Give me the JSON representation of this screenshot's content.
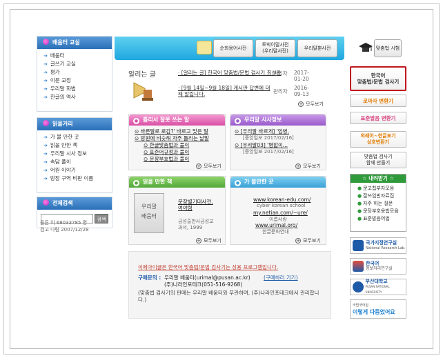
{
  "left": {
    "menu1": {
      "title": "배움터 교실",
      "items": [
        "배움터",
        "글쓰기 교실",
        "평가",
        "이문 교정",
        "우리말 화법",
        "한글의 역사"
      ]
    },
    "menu2": {
      "title": "읽을거리",
      "items": [
        "가 볼 만한 곳",
        "읽을 만한 책",
        "우리말 시사 정보",
        "속담 풀이",
        "어원 이야기",
        "방장 구역 비판 이름"
      ]
    },
    "search": {
      "title": "전체검색",
      "button": "검색"
    },
    "visits": [
      "들른 이 68033785 명",
      "검고 다림 2007/12/28"
    ]
  },
  "top": {
    "tabs": [
      "순화용어사전",
      "토박이말사전\n(우리말사전)",
      "우리말뿐사전",
      "맞춤법 시험"
    ]
  },
  "notice": {
    "title": "알리는 글",
    "rows": [
      {
        "text": "· [알리는 글] 한국어 맞춤법/문법 검사기 최신판",
        "author": "관리자",
        "date": "2017-01-20"
      },
      {
        "text": "· [9월 14일~9월 18일] 게시판 답변에 대해 알립니다.",
        "author": "관리자",
        "date": "2016-09-13"
      }
    ],
    "more": "모두보기"
  },
  "panels": {
    "p1": {
      "title": "틀리서 잘못 쓰는 말",
      "lines": [
        "⊙ 바른말로 로감?' 바르고 맞은 말",
        "⊙ 방원에 비슷해 자주 틀리는 낱말",
        "⊙ 한글맞춤법과 풀이",
        "⊙ 표준어규정과 풀이",
        "⊙ 문장부호법과 풀이"
      ],
      "more": "모두보기"
    },
    "p2": {
      "title": "우리말 시사정보",
      "lines": [
        "⊙ [우리말 바르게] '엄병,",
        "[중앙일보 2017/02/16]",
        "⊙ [우리말03] '명합이...",
        "[중앙일보 2017/02/16]"
      ],
      "more": "모두보기"
    },
    "p3": {
      "title": "읽을 만한 책",
      "book": [
        "우리말",
        "배움터"
      ],
      "lines": [
        "문장별기대사전,",
        "여야렴",
        "금성출판사금성교",
        "과서, 1999"
      ],
      "more": "모두보기"
    },
    "p4": {
      "title": "가 볼만한 곳",
      "lines": [
        "www.korean-edu.com/",
        "cyber korean school",
        "my.netian.com/~ure/",
        "이름사랑",
        "www.urimal.org/",
        "한글문화연대"
      ],
      "more": "모두보기"
    }
  },
  "bottom": {
    "line1": "이메아이글은 한국어 맞춤법/문법 검사기는 상용 프로그램입니다.",
    "contact_label": "구매문의 :",
    "contact1": "우리말 배움터(urimal@pusan.ac.kr)",
    "contact1_link": "(구매하러 가기)",
    "contact2": "(주)나라인포테크(051-516-9268)",
    "note": "(맞춤법 검사기의 판매는 우리말 배움터와 무관하며, (주)나라인포테크에서 관리합니다.)"
  },
  "right": {
    "buttons": [
      {
        "label": "한국어\n맞춤법/문법 검사기",
        "color": "#222"
      },
      {
        "label": "로마자 변환기",
        "color": "#e07a00"
      },
      {
        "label": "표준발음 변환기",
        "color": "#d63a7a"
      },
      {
        "label": "외래어~한글표기\n상호변환기",
        "color": "#e07a00"
      },
      {
        "label": "맞춤법 검사기\n함께 만들기",
        "color": "#333"
      }
    ],
    "links": {
      "title": "☆ 내려받기 ☆",
      "items": [
        "문고칩부자모음",
        "잘쓰임빈자료집",
        "자주 하는 질문",
        "문장부호용법모음",
        "표준발음어법"
      ]
    },
    "logos": [
      {
        "name": "국가지정연구실",
        "sub": "National Research Lab.",
        "color": "#1e5aa8"
      },
      {
        "name": "한국어",
        "sub": "정보처리연구실",
        "color": "#1e5aa8"
      },
      {
        "name": "부산대학교",
        "sub": "PUSAN NATIONAL UNIVERSITY",
        "color": "#1e5aa8"
      },
      {
        "name": "이렇게 다듬었어요",
        "sub": "국립국어원",
        "color": "#1a7fd0"
      }
    ]
  }
}
